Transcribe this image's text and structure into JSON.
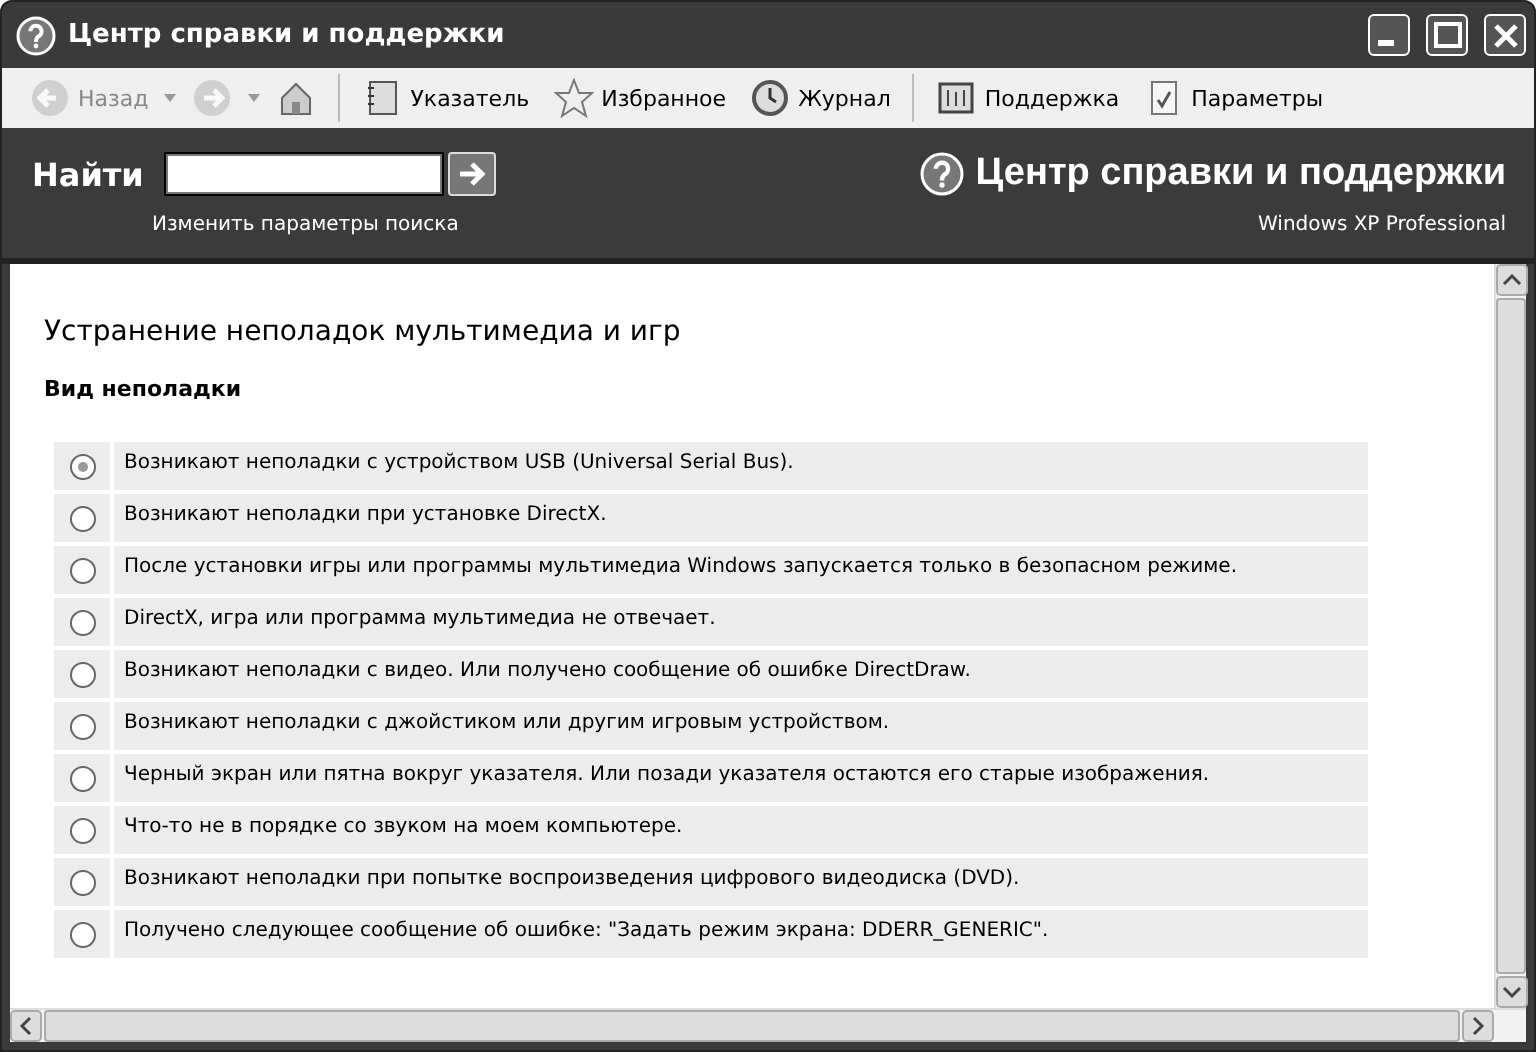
{
  "window": {
    "title": "Центр справки и поддержки"
  },
  "toolbar": [
    {
      "kind": "back",
      "label": "Назад",
      "disabled": true
    },
    {
      "kind": "forward",
      "disabled": true
    },
    {
      "kind": "home"
    },
    {
      "kind": "sep"
    },
    {
      "kind": "index",
      "label": "Указатель"
    },
    {
      "kind": "favorites",
      "label": "Избранное"
    },
    {
      "kind": "history",
      "label": "Журнал"
    },
    {
      "kind": "sep"
    },
    {
      "kind": "support",
      "label": "Поддержка"
    },
    {
      "kind": "options",
      "label": "Параметры"
    }
  ],
  "search": {
    "label": "Найти",
    "link": "Изменить параметры поиска"
  },
  "header": {
    "title": "Центр справки и поддержки",
    "edition": "Windows XP Professional"
  },
  "content": {
    "heading": "Устранение неполадок мультимедиа и игр",
    "subheading": "Вид неполадки",
    "options": [
      {
        "text": "Возникают неполадки с устройством USB (Universal Serial Bus).",
        "selected": true
      },
      {
        "text": "Возникают неполадки при установке DirectX.",
        "selected": false
      },
      {
        "text": "После установки игры или программы мультимедиа Windows запускается только в безопасном режиме.",
        "selected": false
      },
      {
        "text": "DirectX, игра или программа мультимедиа не отвечает.",
        "selected": false
      },
      {
        "text": "Возникают неполадки с видео. Или получено сообщение об ошибке DirectDraw.",
        "selected": false
      },
      {
        "text": "Возникают неполадки с джойстиком или другим игровым устройством.",
        "selected": false
      },
      {
        "text": "Черный экран или пятна вокруг указателя. Или позади указателя остаются его старые изображения.",
        "selected": false
      },
      {
        "text": "Что-то не в порядке со звуком на моем компьютере.",
        "selected": false
      },
      {
        "text": "Возникают неполадки при попытке воспроизведения цифрового видеодиска (DVD).",
        "selected": false
      },
      {
        "text": "Получено следующее сообщение об ошибке: \"Задать режим экрана: DDERR_GENERIC\".",
        "selected": false
      }
    ]
  }
}
